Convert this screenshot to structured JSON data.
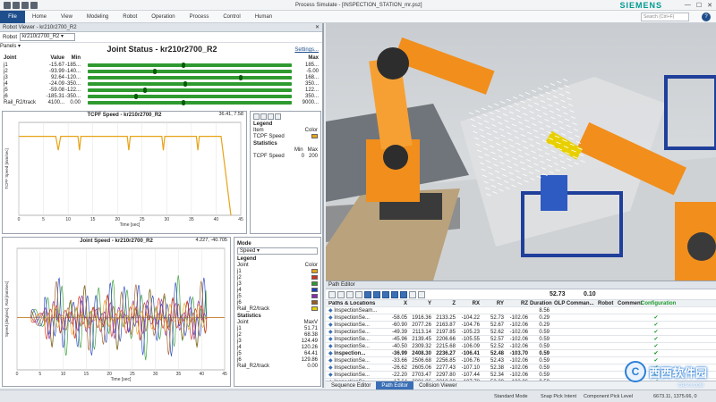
{
  "window": {
    "app": "Process Simulate",
    "file": "[INSPECTION_STATION_mr.psz]",
    "brand": "SIEMENS"
  },
  "menu": {
    "file": "File",
    "items": [
      "Home",
      "View",
      "Modeling",
      "Robot",
      "Operation",
      "Process",
      "Control",
      "Human"
    ],
    "search_placeholder": "Search (Ctrl+F)"
  },
  "robot_viewer": {
    "title": "Robot Viewer - kr210r2700_R2",
    "robot_label": "Robot",
    "robot_value": "kr210r2700_R2",
    "panels_label": "Panels",
    "settings": "Settings...",
    "joint_status_title": "Joint Status - kr210r2700_R2",
    "joint_headers": {
      "joint": "Joint",
      "value": "Value",
      "min": "Min",
      "max": "Max"
    },
    "joints": [
      {
        "name": "j1",
        "value": "-15.67",
        "min": "-185...",
        "max": "185...",
        "pos": 0.46
      },
      {
        "name": "j2",
        "value": "-93.99",
        "min": "-140...",
        "max": "-5.00",
        "pos": 0.32
      },
      {
        "name": "j3",
        "value": "92.64",
        "min": "-120...",
        "max": "168...",
        "pos": 0.74
      },
      {
        "name": "j4",
        "value": "-24.09",
        "min": "-350...",
        "max": "350...",
        "pos": 0.47
      },
      {
        "name": "j5",
        "value": "-59.08",
        "min": "-122...",
        "max": "122...",
        "pos": 0.27
      },
      {
        "name": "j6",
        "value": "-185.31",
        "min": "-350...",
        "max": "350...",
        "pos": 0.23
      },
      {
        "name": "Rail_R2/track",
        "value": "4100...",
        "min": "0.00",
        "max": "9000...",
        "pos": 0.46
      }
    ]
  },
  "tcpf_chart": {
    "title": "TCPF Speed - kr210r2700_R2",
    "coord": "36.41, 7.58",
    "legend_title": "Legend",
    "legend_item_header": "Item",
    "legend_color_header": "Color",
    "legend_item": "TCPF Speed",
    "statistics_title": "Statistics",
    "stats_min_header": "Min",
    "stats_max_header": "Max",
    "stats_min": "0",
    "stats_max": "200"
  },
  "joint_chart": {
    "title": "Joint Speed - kr210r2700_R2",
    "coord": "4.227, -40.705",
    "mode_label": "Mode",
    "mode_value": "Speed",
    "legend_title": "Legend",
    "joint_header": "Joint",
    "color_header": "Color",
    "joints": [
      {
        "name": "j1",
        "color": "#e8a317"
      },
      {
        "name": "j2",
        "color": "#d03020"
      },
      {
        "name": "j3",
        "color": "#2e9a2e"
      },
      {
        "name": "j4",
        "color": "#2040c0"
      },
      {
        "name": "j5",
        "color": "#8a2bb0"
      },
      {
        "name": "j6",
        "color": "#9a5a20"
      },
      {
        "name": "Rail_R2/track",
        "color": "#e8d000"
      }
    ],
    "statistics_title": "Statistics",
    "stats_headers": {
      "joint": "Joint",
      "max": "MaxV"
    },
    "stats": [
      {
        "name": "j1",
        "max": "51.71"
      },
      {
        "name": "j2",
        "max": "68.38"
      },
      {
        "name": "j3",
        "max": "124.49"
      },
      {
        "name": "j4",
        "max": "120.26"
      },
      {
        "name": "j5",
        "max": "64.41"
      },
      {
        "name": "j6",
        "max": "129.86"
      },
      {
        "name": "Rail_R2/track",
        "max": "0.00"
      }
    ]
  },
  "chart_data": [
    {
      "type": "line",
      "title": "TCPF Speed - kr210r2700_R2",
      "xlabel": "Time [sec]",
      "ylabel": "TCPF Speed [mm/sec]",
      "x_ticks": [
        "0",
        "5",
        "10",
        "15",
        "20",
        "25",
        "30",
        "35",
        "40",
        "45"
      ],
      "xlim": [
        0,
        45
      ],
      "ylim": [
        0,
        200
      ],
      "series": [
        {
          "name": "TCPF Speed",
          "color": "#e8a317",
          "x": [
            0,
            7.5,
            8,
            8.5,
            9,
            12,
            12.3,
            12.6,
            13,
            22,
            22.3,
            22.6,
            23,
            29,
            29.3,
            29.6,
            30,
            36,
            36.3,
            36.6,
            37,
            41,
            43
          ],
          "y": [
            170,
            170,
            140,
            170,
            170,
            170,
            140,
            170,
            170,
            170,
            140,
            170,
            170,
            170,
            140,
            170,
            170,
            170,
            140,
            170,
            170,
            170,
            0
          ]
        }
      ]
    },
    {
      "type": "line",
      "title": "Joint Speed - kr210r2700_R2",
      "xlabel": "Time [sec]",
      "ylabel": "Speed [deg/sec], Rail [mm/sec]",
      "x_ticks": [
        "0",
        "5",
        "10",
        "15",
        "20",
        "25",
        "30",
        "35",
        "40",
        "45"
      ],
      "xlim": [
        0,
        45
      ],
      "ylim": [
        -150,
        200
      ],
      "series": [
        {
          "name": "j3",
          "color": "#2e9a2e",
          "amp": 124
        },
        {
          "name": "j4",
          "color": "#2040c0",
          "amp": 120
        },
        {
          "name": "j6",
          "color": "#9a5a20",
          "amp": 110
        },
        {
          "name": "j5",
          "color": "#8a2bb0",
          "amp": 64
        },
        {
          "name": "j2",
          "color": "#d03020",
          "amp": 68
        },
        {
          "name": "j1",
          "color": "#e8a317",
          "amp": 51
        }
      ]
    }
  ],
  "path_editor": {
    "title": "Path Editor",
    "counter": "52.73",
    "speed": "0.10",
    "headers": [
      "Paths & Locations",
      "X",
      "Y",
      "Z",
      "RX",
      "RY",
      "RZ",
      "Duration",
      "OLP Comman...",
      "Robot",
      "Comment",
      "Configuration"
    ],
    "rows": [
      {
        "name": "InspectionSeam...",
        "x": "",
        "y": "",
        "z": "",
        "rx": "",
        "ry": "",
        "rz": "",
        "dur": "8.56",
        "bold": false,
        "check": ""
      },
      {
        "name": "InspectionSe...",
        "x": "-58.05",
        "y": "1916.36",
        "z": "2133.25",
        "rx": "-104.22",
        "ry": "52.73",
        "rz": "-102.06",
        "dur": "0.29",
        "bold": false,
        "check": "✔"
      },
      {
        "name": "InspectionSe...",
        "x": "-60.90",
        "y": "2077.26",
        "z": "2163.87",
        "rx": "-104.76",
        "ry": "52.67",
        "rz": "-102.06",
        "dur": "0.29",
        "bold": false,
        "check": "✔"
      },
      {
        "name": "InspectionSe...",
        "x": "-49.39",
        "y": "2113.14",
        "z": "2197.85",
        "rx": "-105.23",
        "ry": "52.62",
        "rz": "-102.06",
        "dur": "0.59",
        "bold": false,
        "check": "✔"
      },
      {
        "name": "InspectionSe...",
        "x": "-45.96",
        "y": "2139.45",
        "z": "2206.66",
        "rx": "-105.55",
        "ry": "52.57",
        "rz": "-102.06",
        "dur": "0.59",
        "bold": false,
        "check": "✔"
      },
      {
        "name": "InspectionSe...",
        "x": "-40.50",
        "y": "2309.32",
        "z": "2215.68",
        "rx": "-106.09",
        "ry": "52.52",
        "rz": "-102.06",
        "dur": "0.59",
        "bold": false,
        "check": "✔"
      },
      {
        "name": "Inspection...",
        "x": "-36.99",
        "y": "2408.30",
        "z": "2236.27",
        "rx": "-106.41",
        "ry": "52.48",
        "rz": "-103.70",
        "dur": "0.59",
        "bold": true,
        "check": "✔"
      },
      {
        "name": "InspectionSe...",
        "x": "-33.66",
        "y": "2506.68",
        "z": "2256.85",
        "rx": "-106.76",
        "ry": "52.43",
        "rz": "-102.06",
        "dur": "0.59",
        "bold": false,
        "check": "✔"
      },
      {
        "name": "InspectionSe...",
        "x": "-26.62",
        "y": "2605.06",
        "z": "2277.43",
        "rx": "-107.10",
        "ry": "52.38",
        "rz": "-102.06",
        "dur": "0.59",
        "bold": false,
        "check": "✔"
      },
      {
        "name": "InspectionSe...",
        "x": "-22.20",
        "y": "2703.47",
        "z": "2297.80",
        "rx": "-107.44",
        "ry": "52.34",
        "rz": "-102.06",
        "dur": "0.59",
        "bold": false,
        "check": "✔"
      },
      {
        "name": "InspectionSe...",
        "x": "-17.64",
        "y": "2801.86",
        "z": "2318.08",
        "rx": "-107.78",
        "ry": "52.30",
        "rz": "-102.06",
        "dur": "0.59",
        "bold": false,
        "check": "✔"
      }
    ],
    "tabs": [
      "Sequence Editor",
      "Path Editor",
      "Collision Viewer"
    ],
    "active_tab": 1
  },
  "status": {
    "mode": "Standard Mode",
    "snap": "Snap Pick Intent",
    "level": "Component Pick Level",
    "coords": "6673.11, 1375.66, 0"
  },
  "watermark": {
    "text": "西西软件园",
    "sub": "CR173.COM"
  }
}
